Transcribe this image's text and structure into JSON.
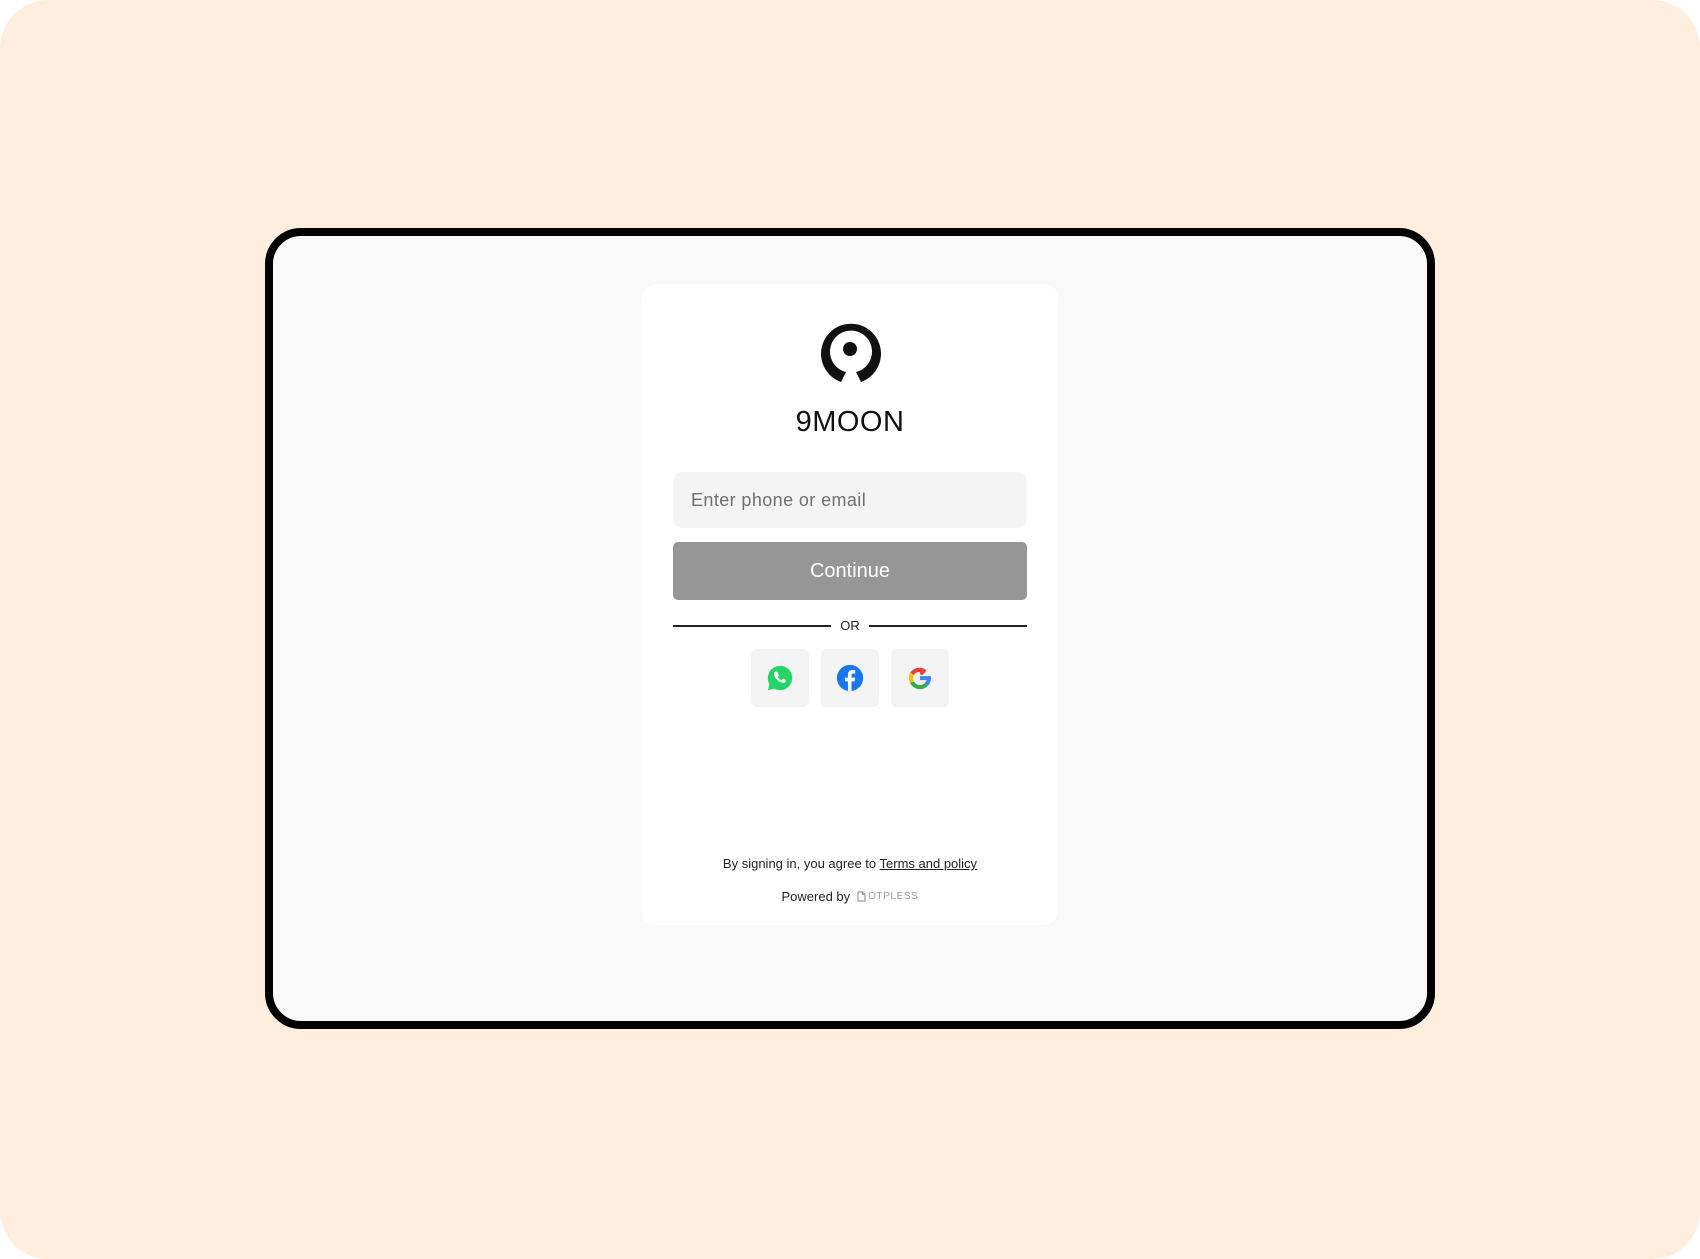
{
  "brand": {
    "name": "9MOON",
    "logo_icon": "crescent-moon-logo-icon"
  },
  "login": {
    "input_placeholder": "Enter phone or email",
    "continue_label": "Continue",
    "divider_label": "OR",
    "social_providers": [
      {
        "name": "WhatsApp",
        "icon": "whatsapp-icon",
        "color": "#25D366"
      },
      {
        "name": "Facebook",
        "icon": "facebook-icon",
        "color": "#1877F2"
      },
      {
        "name": "Google",
        "icon": "google-icon",
        "color": "#4285F4"
      }
    ]
  },
  "footer": {
    "terms_prefix": "By signing in, you agree to ",
    "terms_link": "Terms and policy",
    "powered_by": "Powered by",
    "powered_brand": "OTPLESS"
  },
  "colors": {
    "backdrop": "#FFEEDE",
    "device_frame": "#000000",
    "screen_bg": "#F9F9F9",
    "continue_button": "#969696"
  }
}
